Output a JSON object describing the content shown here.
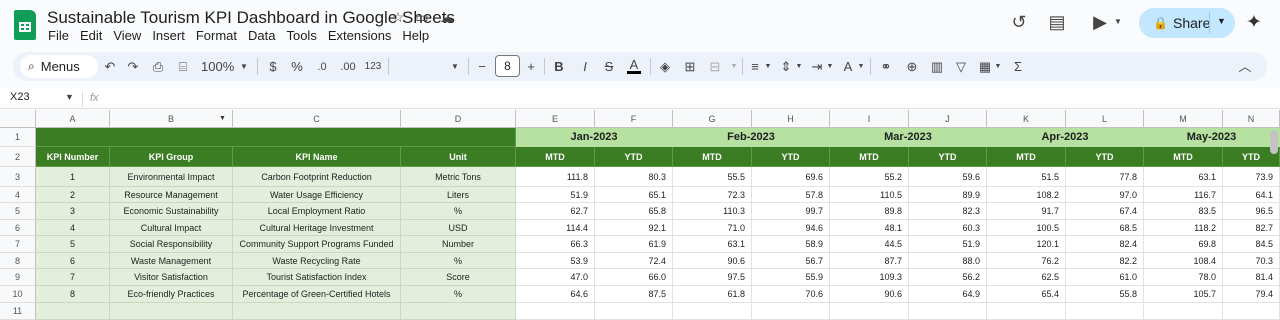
{
  "app": {
    "doc_title": "Sustainable Tourism KPI Dashboard in Google Sheets",
    "menu": [
      "File",
      "Edit",
      "View",
      "Insert",
      "Format",
      "Data",
      "Tools",
      "Extensions",
      "Help"
    ],
    "share_label": "Share",
    "accent": "#0f9d58",
    "share_bg": "#c2e7ff"
  },
  "toolbar": {
    "search_label": "Menus",
    "zoom": "100%",
    "currency": "$",
    "percent": "%",
    "dec_less": ".0",
    "dec_more": ".00",
    "format_123": "123",
    "font_size": "8",
    "bold": "B",
    "italic": "I",
    "strike": "S",
    "text_color": "A",
    "sigma": "Σ"
  },
  "formula_bar": {
    "name_box": "X23",
    "fx": "fx",
    "value": ""
  },
  "sheet": {
    "columns": [
      "A",
      "B",
      "C",
      "D",
      "E",
      "F",
      "G",
      "H",
      "I",
      "J",
      "K",
      "L",
      "M",
      "N"
    ],
    "rows": [
      "1",
      "2",
      "3",
      "4",
      "5",
      "6",
      "7",
      "8",
      "9",
      "10",
      "11"
    ],
    "months": [
      "Jan-2023",
      "Feb-2023",
      "Mar-2023",
      "Apr-2023",
      "May-2023"
    ],
    "headers": [
      "KPI Number",
      "KPI Group",
      "KPI Name",
      "Unit"
    ],
    "mtd_label": "MTD",
    "ytd_label": "YTD",
    "header_dark": "#3a7d22",
    "header_light": "#b7e1a1",
    "kpi_fill": "#e3efdc",
    "data": [
      {
        "num": "1",
        "group": "Environmental Impact",
        "name": "Carbon Footprint Reduction",
        "unit": "Metric Tons",
        "values": [
          "111.8",
          "80.3",
          "55.5",
          "69.6",
          "55.2",
          "59.6",
          "51.5",
          "77.8",
          "63.1",
          "73.9"
        ]
      },
      {
        "num": "2",
        "group": "Resource Management",
        "name": "Water Usage Efficiency",
        "unit": "Liters",
        "values": [
          "51.9",
          "65.1",
          "72.3",
          "57.8",
          "110.5",
          "89.9",
          "108.2",
          "97.0",
          "116.7",
          "64.1"
        ]
      },
      {
        "num": "3",
        "group": "Economic Sustainability",
        "name": "Local Employment Ratio",
        "unit": "%",
        "values": [
          "62.7",
          "65.8",
          "110.3",
          "99.7",
          "89.8",
          "82.3",
          "91.7",
          "67.4",
          "83.5",
          "96.5"
        ]
      },
      {
        "num": "4",
        "group": "Cultural Impact",
        "name": "Cultural Heritage Investment",
        "unit": "USD",
        "values": [
          "114.4",
          "92.1",
          "71.0",
          "94.6",
          "48.1",
          "60.3",
          "100.5",
          "68.5",
          "118.2",
          "82.7"
        ]
      },
      {
        "num": "5",
        "group": "Social Responsibility",
        "name": "Community Support Programs Funded",
        "unit": "Number",
        "values": [
          "66.3",
          "61.9",
          "63.1",
          "58.9",
          "44.5",
          "51.9",
          "120.1",
          "82.4",
          "69.8",
          "84.5"
        ]
      },
      {
        "num": "6",
        "group": "Waste Management",
        "name": "Waste Recycling Rate",
        "unit": "%",
        "values": [
          "53.9",
          "72.4",
          "90.6",
          "56.7",
          "87.7",
          "88.0",
          "76.2",
          "82.2",
          "108.4",
          "70.3"
        ]
      },
      {
        "num": "7",
        "group": "Visitor Satisfaction",
        "name": "Tourist Satisfaction Index",
        "unit": "Score",
        "values": [
          "47.0",
          "66.0",
          "97.5",
          "55.9",
          "109.3",
          "56.2",
          "62.5",
          "61.0",
          "78.0",
          "81.4"
        ]
      },
      {
        "num": "8",
        "group": "Eco-friendly Practices",
        "name": "Percentage of Green-Certified Hotels",
        "unit": "%",
        "values": [
          "64.6",
          "87.5",
          "61.8",
          "70.6",
          "90.6",
          "64.9",
          "65.4",
          "55.8",
          "105.7",
          "79.4"
        ]
      }
    ]
  }
}
